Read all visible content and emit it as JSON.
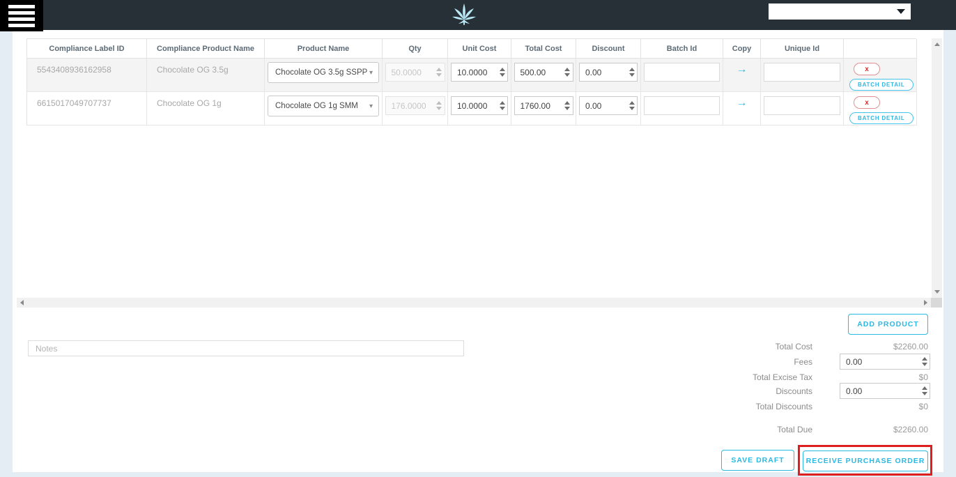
{
  "colors": {
    "accent": "#29b9e3",
    "topbar_bg": "#272f37",
    "highlight_red": "#dd1f1f",
    "row_stripe": "#f4f4f4"
  },
  "topbar": {
    "select_value": ""
  },
  "table": {
    "columns": [
      "Compliance Label ID",
      "Compliance Product Name",
      "Product Name",
      "Qty",
      "Unit Cost",
      "Total Cost",
      "Discount",
      "Batch Id",
      "Copy",
      "Unique Id",
      ""
    ],
    "batch_detail_label": "BATCH DETAIL",
    "rows": [
      {
        "compliance_label_id": "5543408936162958",
        "compliance_product_name": "Chocolate OG 3.5g",
        "product_name": "Chocolate OG 3.5g SSPP",
        "qty": "50.0000",
        "unit_cost": "10.0000",
        "total_cost": "500.00",
        "discount": "0.00",
        "batch_id": "",
        "unique_id": ""
      },
      {
        "compliance_label_id": "6615017049707737",
        "compliance_product_name": "Chocolate OG 1g",
        "product_name": "Chocolate OG 1g SMM",
        "qty": "176.0000",
        "unit_cost": "10.0000",
        "total_cost": "1760.00",
        "discount": "0.00",
        "batch_id": "",
        "unique_id": ""
      }
    ]
  },
  "footer": {
    "add_product_label": "ADD PRODUCT",
    "notes_placeholder": "Notes",
    "totals": [
      {
        "label": "Total Cost",
        "value": "$2260.00"
      },
      {
        "label": "Fees",
        "value": "0.00"
      },
      {
        "label": "Total Excise Tax",
        "value": "$0"
      },
      {
        "label": "Discounts",
        "value": "0.00"
      },
      {
        "label": "Total Discounts",
        "value": "$0"
      }
    ],
    "total_due": {
      "label": "Total Due",
      "value": "$2260.00"
    },
    "save_draft_label": "SAVE DRAFT",
    "receive_po_label": "RECEIVE PURCHASE ORDER"
  }
}
